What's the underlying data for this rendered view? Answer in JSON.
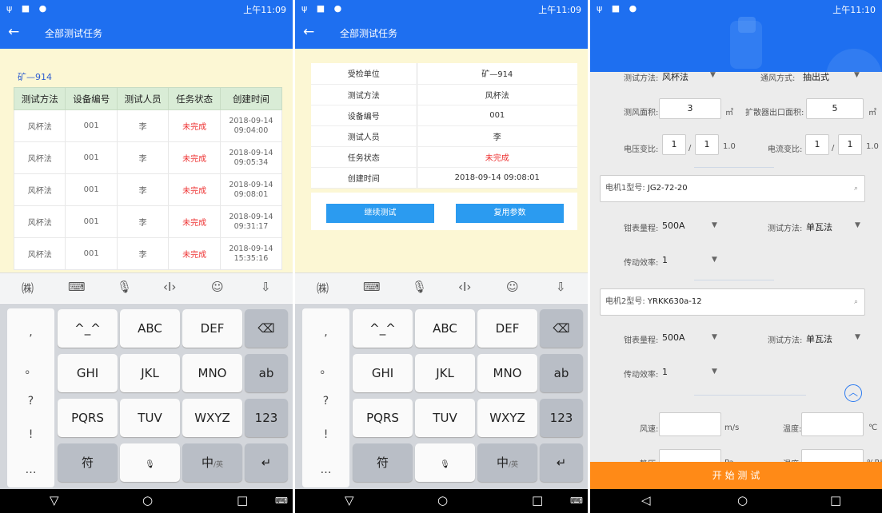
{
  "status": {
    "time1": "上午11:09",
    "time3": "上午11:10"
  },
  "appbar": {
    "back": "←",
    "title": "全部测试任务"
  },
  "list": {
    "task_name": "矿—914",
    "headers": [
      "测试方法",
      "设备编号",
      "测试人员",
      "任务状态",
      "创建时间"
    ],
    "rows": [
      {
        "method": "风杯法",
        "device": "001",
        "person": "李",
        "status": "未完成",
        "date": "2018-09-14",
        "time": "09:04:00"
      },
      {
        "method": "风杯法",
        "device": "001",
        "person": "李",
        "status": "未完成",
        "date": "2018-09-14",
        "time": "09:05:34"
      },
      {
        "method": "风杯法",
        "device": "001",
        "person": "李",
        "status": "未完成",
        "date": "2018-09-14",
        "time": "09:08:01"
      },
      {
        "method": "风杯法",
        "device": "001",
        "person": "李",
        "status": "未完成",
        "date": "2018-09-14",
        "time": "09:31:17"
      },
      {
        "method": "风杯法",
        "device": "001",
        "person": "李",
        "status": "未完成",
        "date": "2018-09-14",
        "time": "15:35:16"
      }
    ]
  },
  "detail": {
    "rows": [
      {
        "k": "受检单位",
        "v": "矿—914"
      },
      {
        "k": "测试方法",
        "v": "风杯法"
      },
      {
        "k": "设备编号",
        "v": "001"
      },
      {
        "k": "测试人员",
        "v": "李"
      },
      {
        "k": "任务状态",
        "v": "未完成"
      },
      {
        "k": "创建时间",
        "v": "2018-09-14 09:08:01"
      }
    ],
    "continue_btn": "继续测试",
    "reuse_btn": "复用参数"
  },
  "keyboard": {
    "left": [
      ",",
      "。",
      "?",
      "!",
      "…"
    ],
    "r1": [
      "^_^",
      "ABC",
      "DEF"
    ],
    "r2": [
      "GHI",
      "JKL",
      "MNO",
      "ab"
    ],
    "r3": [
      "PQRS",
      "TUV",
      "WXYZ",
      "123"
    ],
    "r4a": "符",
    "r4c": "中",
    "r4c_sub": "/英",
    "del": "⌫",
    "enter": "↵",
    "tools": [
      "㈱",
      "⌨",
      "🎙",
      "‹I›",
      "☺",
      "⇩"
    ]
  },
  "nav": {
    "back": "▽",
    "home": "○",
    "recent": "□",
    "kb": "⌨",
    "back3": "◁"
  },
  "form": {
    "test_method_lbl": "测试方法:",
    "test_method_val": "风杯法",
    "vent_lbl": "通风方式:",
    "vent_val": "抽出式",
    "area_lbl": "测风面积:",
    "area_val": "3",
    "area_unit": "㎡",
    "diff_lbl": "扩散器出口面积:",
    "diff_val": "5",
    "diff_unit": "㎡",
    "v_lbl": "电压变比:",
    "v1": "1",
    "v2": "1",
    "v_res": "1.0",
    "c_lbl": "电流变比:",
    "c1": "1",
    "c2": "1",
    "c_res": "1.0",
    "slash": "/",
    "m1_lbl": "电机1型号:",
    "m1_val": "JG2-72-20",
    "m2_lbl": "电机2型号:",
    "m2_val": "YRKK630a-12",
    "clamp_lbl": "钳表量程:",
    "clamp_val": "500A",
    "method2_lbl": "测试方法:",
    "method2_val": "单瓦法",
    "eff_lbl": "传动效率:",
    "eff_val": "1",
    "wind_lbl": "风速:",
    "wind_unit": "m/s",
    "temp_lbl": "温度:",
    "temp_unit": "℃",
    "static_lbl": "静压:",
    "static_unit": "Pa",
    "hum_lbl": "湿度:",
    "hum_unit": "%RH",
    "start_btn": "开 始 测 试",
    "search": "⌕",
    "dd": "▼",
    "chev": "︿"
  }
}
